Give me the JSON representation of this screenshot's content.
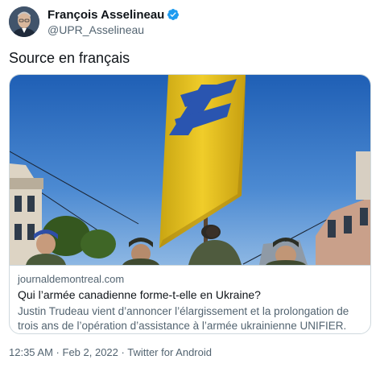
{
  "author": {
    "display_name": "François Asselineau",
    "handle": "@UPR_Asselineau",
    "verified": true
  },
  "tweet": {
    "text": "Source en français"
  },
  "card": {
    "domain": "journaldemontreal.com",
    "title": "Qui l’armée canadienne forme-t-elle en Ukraine?",
    "description": "Justin Trudeau vient d’annoncer l’élargissement et la prolongation de trois ans de l’opération d’assistance à l’armée ukrainienne UNIFIER."
  },
  "meta": {
    "time": "12:35 AM",
    "separator": " · ",
    "date": "Feb 2, 2022",
    "source": "Twitter for Android"
  },
  "colors": {
    "verified_badge": "#1d9bf0",
    "secondary_text": "#536471",
    "border": "#cfd9de",
    "banner_yellow": "#e8c21a",
    "banner_blue": "#2a55b0"
  }
}
